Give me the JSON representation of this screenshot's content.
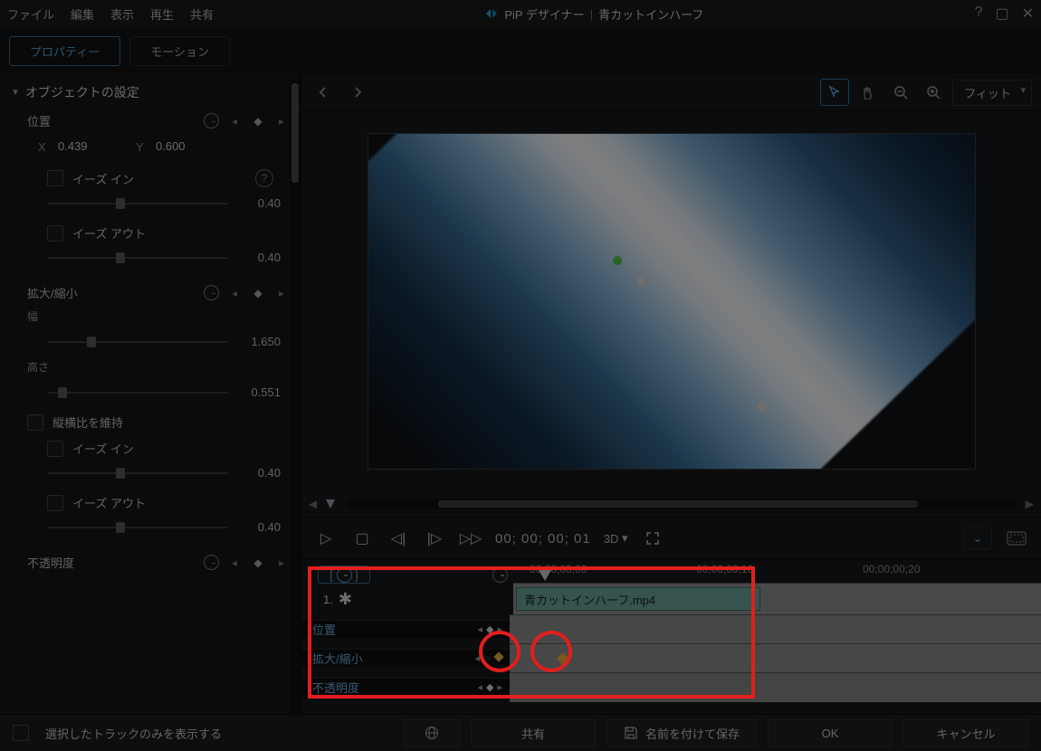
{
  "menu": {
    "file": "ファイル",
    "edit": "編集",
    "view": "表示",
    "play": "再生",
    "share": "共有"
  },
  "title": {
    "app": "PiP デザイナー",
    "sep": "|",
    "project": "青カットインハーフ"
  },
  "windowControls": {
    "help": "?",
    "max": "▢",
    "close": "✕"
  },
  "tabs": {
    "properties": "プロパティー",
    "motion": "モーション"
  },
  "sections": {
    "object": "オブジェクトの設定"
  },
  "position": {
    "label": "位置",
    "xLabel": "X",
    "xVal": "0.439",
    "yLabel": "Y",
    "yVal": "0.600",
    "easeIn": "イーズ イン",
    "easeOut": "イーズ アウト",
    "easeInVal": "0.40",
    "easeOutVal": "0.40",
    "help": "?"
  },
  "scale": {
    "label": "拡大/縮小",
    "widthLabel": "幅",
    "widthVal": "1.650",
    "heightLabel": "高さ",
    "heightVal": "0.551",
    "aspect": "縦横比を維持",
    "easeIn": "イーズ イン",
    "easeInVal": "0.40",
    "easeOut": "イーズ アウト",
    "easeOutVal": "0.40"
  },
  "opacity": {
    "label": "不透明度"
  },
  "fit": {
    "label": "フィット"
  },
  "playbar": {
    "timecode": "00; 00; 00; 01",
    "threeD": "3D"
  },
  "ruler": {
    "t0": "00;00;00;00",
    "t1": "00;00;00;10",
    "t2": "00;00;00;20"
  },
  "clip": {
    "index": "1.",
    "name": "青カットインハーフ.mp4"
  },
  "tlParams": {
    "pos": "位置",
    "scale": "拡大/縮小",
    "opacity": "不透明度"
  },
  "footer": {
    "trackOnly": "選択したトラックのみを表示する",
    "share": "共有",
    "saveAs": "名前を付けて保存",
    "ok": "OK",
    "cancel": "キャンセル"
  }
}
